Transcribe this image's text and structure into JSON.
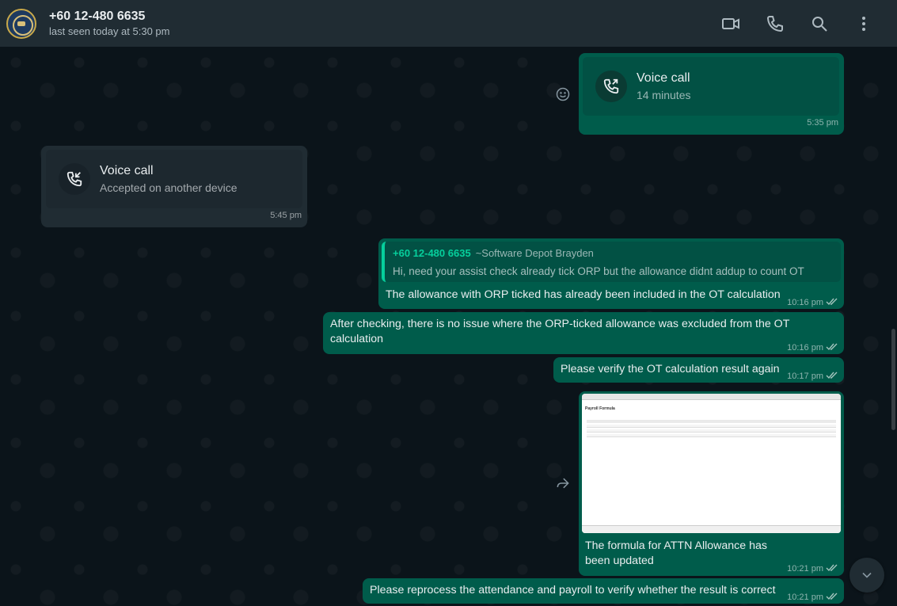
{
  "header": {
    "contact_name": "+60 12-480 6635",
    "status": "last seen today at 5:30 pm",
    "icons": [
      "video-call-icon",
      "voice-call-icon",
      "search-icon",
      "menu-icon"
    ]
  },
  "messages": {
    "call_out": {
      "title": "Voice call",
      "subtitle": "14 minutes",
      "time": "5:35 pm"
    },
    "call_in": {
      "title": "Voice call",
      "subtitle": "Accepted on another device",
      "time": "5:45 pm"
    },
    "reply": {
      "quote_name": "+60 12-480 6635",
      "quote_alias": "~Software Depot Brayden",
      "quote_text": "Hi, need your assist check already tick ORP but the allowance didnt addup to count OT",
      "text": "The allowance with ORP ticked has already been included in the OT calculation",
      "time": "10:16 pm"
    },
    "msg2": {
      "text": "After checking, there is no issue where the ORP-ticked allowance was excluded from the OT calculation",
      "time": "10:16 pm"
    },
    "msg3": {
      "text": "Please verify the OT calculation result again",
      "time": "10:17 pm"
    },
    "image_msg": {
      "caption": "The formula for ATTN Allowance has been updated",
      "time": "10:21 pm",
      "thumb_title": "Payroll Formula"
    },
    "msg5": {
      "text": "Please reprocess the attendance and payroll to verify whether the result is correct",
      "time": "10:21 pm"
    }
  },
  "colors": {
    "outgoing": "#005c4b",
    "incoming": "#202c33",
    "background": "#0b141a",
    "accent": "#06cf9c"
  }
}
